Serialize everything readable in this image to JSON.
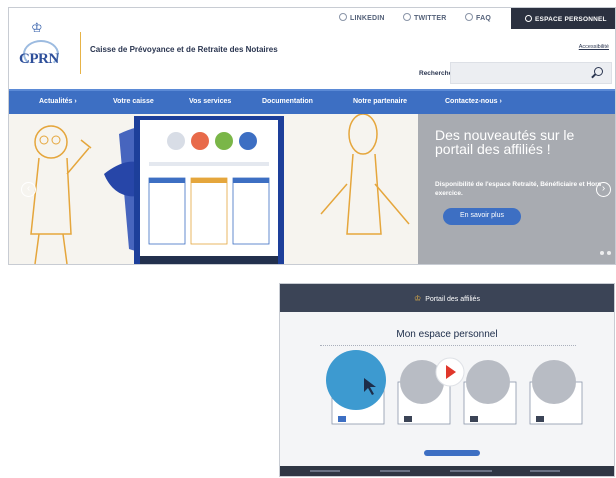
{
  "top_bar": {
    "linkedin": "LINKEDIN",
    "twitter": "TWITTER",
    "faq": "FAQ",
    "espace_personnel": "ESPACE PERSONNEL"
  },
  "logo": {
    "text": "CPRN"
  },
  "site_title": "Caisse de Prévoyance et de Retraite des Notaires",
  "accessibility_link": "Accessibilité",
  "search": {
    "label": "Recherche",
    "placeholder": ""
  },
  "nav": {
    "items": [
      {
        "label": "Actualités ›"
      },
      {
        "label": "Votre caisse"
      },
      {
        "label": "Vos services"
      },
      {
        "label": "Documentation"
      },
      {
        "label": "Notre partenaire"
      },
      {
        "label": "Contactez-nous ›"
      }
    ]
  },
  "hero": {
    "heading": "Des nouveautés sur le portail des affiliés !",
    "text": "Disponibilité de l'espace Retraité, Bénéficiaire et Hors exercice.",
    "button": "En savoir plus",
    "prev": "‹",
    "next": "›"
  },
  "portal": {
    "header": "Portail des affiliés",
    "title": "Mon espace personnel"
  },
  "colors": {
    "brand_blue": "#3d6fc3",
    "dark_header": "#2b3140",
    "hero_panel": "#a8abb1",
    "accent_gold": "#e7b347"
  }
}
